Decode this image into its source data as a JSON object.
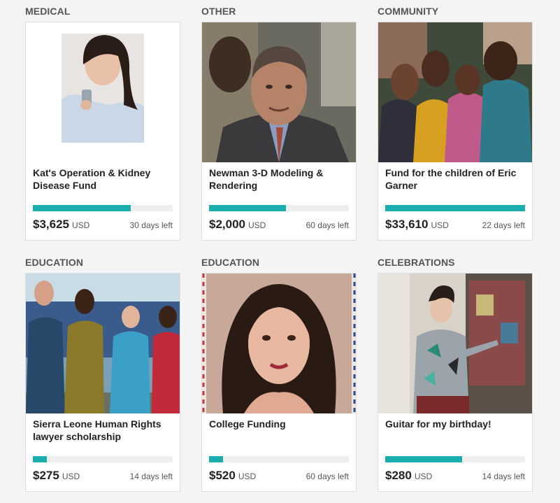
{
  "campaigns": [
    {
      "category": "MEDICAL",
      "title": "Kat's Operation & Kidney Disease Fund",
      "amount": "$3,625",
      "currency": "USD",
      "days_left": "30 days left",
      "progress": 0.7
    },
    {
      "category": "OTHER",
      "title": "Newman 3-D Modeling & Rendering",
      "amount": "$2,000",
      "currency": "USD",
      "days_left": "60 days left",
      "progress": 0.55
    },
    {
      "category": "COMMUNITY",
      "title": "Fund for the children of Eric Garner",
      "amount": "$33,610",
      "currency": "USD",
      "days_left": "22 days left",
      "progress": 1.0
    },
    {
      "category": "EDUCATION",
      "title": "Sierra Leone Human Rights lawyer scholarship",
      "amount": "$275",
      "currency": "USD",
      "days_left": "14 days left",
      "progress": 0.1
    },
    {
      "category": "EDUCATION",
      "title": "College Funding",
      "amount": "$520",
      "currency": "USD",
      "days_left": "60 days left",
      "progress": 0.1
    },
    {
      "category": "CELEBRATIONS",
      "title": "Guitar for my birthday!",
      "amount": "$280",
      "currency": "USD",
      "days_left": "14 days left",
      "progress": 0.55
    }
  ],
  "colors": {
    "progress_fill": "#1aafae",
    "progress_track": "#eeeeee",
    "card_border": "#dddddd",
    "background": "#f4f4f4"
  }
}
